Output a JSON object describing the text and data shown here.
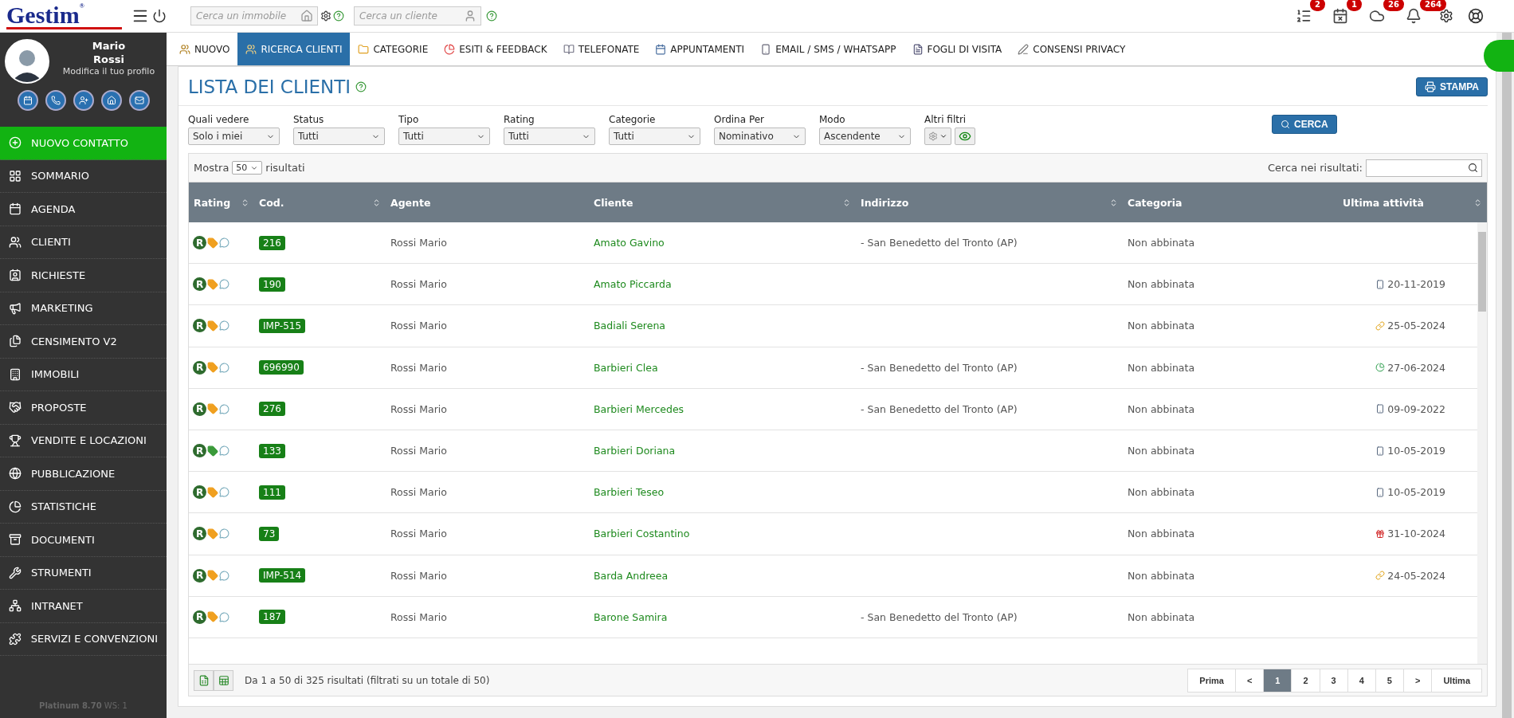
{
  "topbar": {
    "logo": "Gestim",
    "logo_mark": "®",
    "search_property": {
      "placeholder": "Cerca un immobile"
    },
    "search_client": {
      "placeholder": "Cerca un cliente"
    },
    "notifications": [
      {
        "kind": "list",
        "badge": "2"
      },
      {
        "kind": "calendar",
        "badge": "1"
      },
      {
        "kind": "cloud",
        "badge": "26"
      },
      {
        "kind": "bell",
        "badge": "264"
      }
    ]
  },
  "profile": {
    "first_name": "Mario",
    "last_name": "Rossi",
    "edit_link": "Modifica il tuo profilo"
  },
  "sidebar": {
    "items": [
      {
        "label": "NUOVO CONTATTO",
        "selected": true
      },
      {
        "label": "SOMMARIO",
        "selected": false
      },
      {
        "label": "AGENDA",
        "selected": false
      },
      {
        "label": "CLIENTI",
        "selected": false
      },
      {
        "label": "RICHIESTE",
        "selected": false
      },
      {
        "label": "MARKETING",
        "selected": false
      },
      {
        "label": "CENSIMENTO V2",
        "selected": false
      },
      {
        "label": "IMMOBILI",
        "selected": false
      },
      {
        "label": "PROPOSTE",
        "selected": false
      },
      {
        "label": "VENDITE E LOCAZIONI",
        "selected": false
      },
      {
        "label": "PUBBLICAZIONE",
        "selected": false
      },
      {
        "label": "STATISTICHE",
        "selected": false
      },
      {
        "label": "DOCUMENTI",
        "selected": false
      },
      {
        "label": "STRUMENTI",
        "selected": false
      },
      {
        "label": "INTRANET",
        "selected": false
      },
      {
        "label": "SERVIZI E CONVENZIONI",
        "selected": false
      }
    ],
    "version": "Platinum 8.70",
    "workstation": "WS: 1"
  },
  "tabs": [
    {
      "label": "NUOVO",
      "selected": false
    },
    {
      "label": "RICERCA CLIENTI",
      "selected": true
    },
    {
      "label": "CATEGORIE",
      "selected": false
    },
    {
      "label": "ESITI & FEEDBACK",
      "selected": false
    },
    {
      "label": "TELEFONATE",
      "selected": false
    },
    {
      "label": "APPUNTAMENTI",
      "selected": false
    },
    {
      "label": "EMAIL / SMS / WHATSAPP",
      "selected": false
    },
    {
      "label": "FOGLI DI VISITA",
      "selected": false
    },
    {
      "label": "CONSENSI PRIVACY",
      "selected": false
    }
  ],
  "page": {
    "title": "LISTA DEI CLIENTI",
    "print_button": "STAMPA",
    "search_button": "CERCA"
  },
  "filters": [
    {
      "label": "Quali vedere",
      "value": "Solo i miei"
    },
    {
      "label": "Status",
      "value": "Tutti"
    },
    {
      "label": "Tipo",
      "value": "Tutti"
    },
    {
      "label": "Rating",
      "value": "Tutti"
    },
    {
      "label": "Categorie",
      "value": "Tutti"
    },
    {
      "label": "Ordina Per",
      "value": "Nominativo"
    },
    {
      "label": "Modo",
      "value": "Ascendente"
    }
  ],
  "other_filters": {
    "label": "Altri filtri"
  },
  "table": {
    "show_label": "Mostra",
    "page_size": "50",
    "show_suffix": "risultati",
    "search_label": "Cerca nei risultati:",
    "columns": [
      {
        "label": "Rating",
        "sortable": true
      },
      {
        "label": "Cod.",
        "sortable": true
      },
      {
        "label": "Agente",
        "sortable": false
      },
      {
        "label": "Cliente",
        "sortable": true
      },
      {
        "label": "Indirizzo",
        "sortable": true
      },
      {
        "label": "Categoria",
        "sortable": false
      },
      {
        "label": "Ultima attività",
        "sortable": true
      }
    ],
    "rows": [
      {
        "rating": "R",
        "color": "#f0a020",
        "code": "216",
        "agent": "Rossi Mario",
        "client": "Amato Gavino",
        "address": "- San Benedetto del Tronto (AP)",
        "category": "Non abbinata"
      },
      {
        "rating": "R",
        "color": "#f0a020",
        "code": "190",
        "agent": "Rossi Mario",
        "client": "Amato Piccarda",
        "category": "Non abbinata",
        "kind": "phone",
        "activity": "20-11-2019"
      },
      {
        "rating": "R",
        "color": "#f0a020",
        "code": "IMP-515",
        "agent": "Rossi Mario",
        "client": "Badiali Serena",
        "category": "Non abbinata",
        "kind": "link",
        "activity": "25-05-2024"
      },
      {
        "rating": "R",
        "color": "#f0a020",
        "code": "696990",
        "agent": "Rossi Mario",
        "client": "Barbieri Clea",
        "address": "- San Benedetto del Tronto (AP)",
        "category": "Non abbinata",
        "kind": "chart",
        "activity": "27-06-2024"
      },
      {
        "rating": "R",
        "color": "#f0a020",
        "code": "276",
        "agent": "Rossi Mario",
        "client": "Barbieri Mercedes",
        "address": "- San Benedetto del Tronto (AP)",
        "category": "Non abbinata",
        "kind": "phone",
        "activity": "09-09-2022"
      },
      {
        "rating": "R",
        "color": "#3a9a3a",
        "code": "133",
        "agent": "Rossi Mario",
        "client": "Barbieri Doriana",
        "category": "Non abbinata",
        "kind": "phone",
        "activity": "10-05-2019"
      },
      {
        "rating": "R",
        "color": "#f0a020",
        "code": "111",
        "agent": "Rossi Mario",
        "client": "Barbieri Teseo",
        "category": "Non abbinata",
        "kind": "phone",
        "activity": "10-05-2019"
      },
      {
        "rating": "R",
        "color": "#f0a020",
        "code": "73",
        "agent": "Rossi Mario",
        "client": "Barbieri Costantino",
        "category": "Non abbinata",
        "kind": "gift",
        "activity": "31-10-2024"
      },
      {
        "rating": "R",
        "color": "#f0a020",
        "code": "IMP-514",
        "agent": "Rossi Mario",
        "client": "Barda Andreea",
        "category": "Non abbinata",
        "kind": "link",
        "activity": "24-05-2024"
      },
      {
        "rating": "R",
        "color": "#f0a020",
        "code": "187",
        "agent": "Rossi Mario",
        "client": "Barone Samira",
        "address": "- San Benedetto del Tronto (AP)",
        "category": "Non abbinata"
      }
    ],
    "summary": "Da 1 a 50 di 325 risultati (filtrati su un totale di 50)",
    "pagination": [
      {
        "label": "Prima",
        "selected": false
      },
      {
        "label": "<",
        "selected": false
      },
      {
        "label": "1",
        "selected": true
      },
      {
        "label": "2",
        "selected": false
      },
      {
        "label": "3",
        "selected": false
      },
      {
        "label": "4",
        "selected": false
      },
      {
        "label": "5",
        "selected": false
      },
      {
        "label": ">",
        "selected": false
      },
      {
        "label": "Ultima",
        "selected": false
      }
    ]
  }
}
